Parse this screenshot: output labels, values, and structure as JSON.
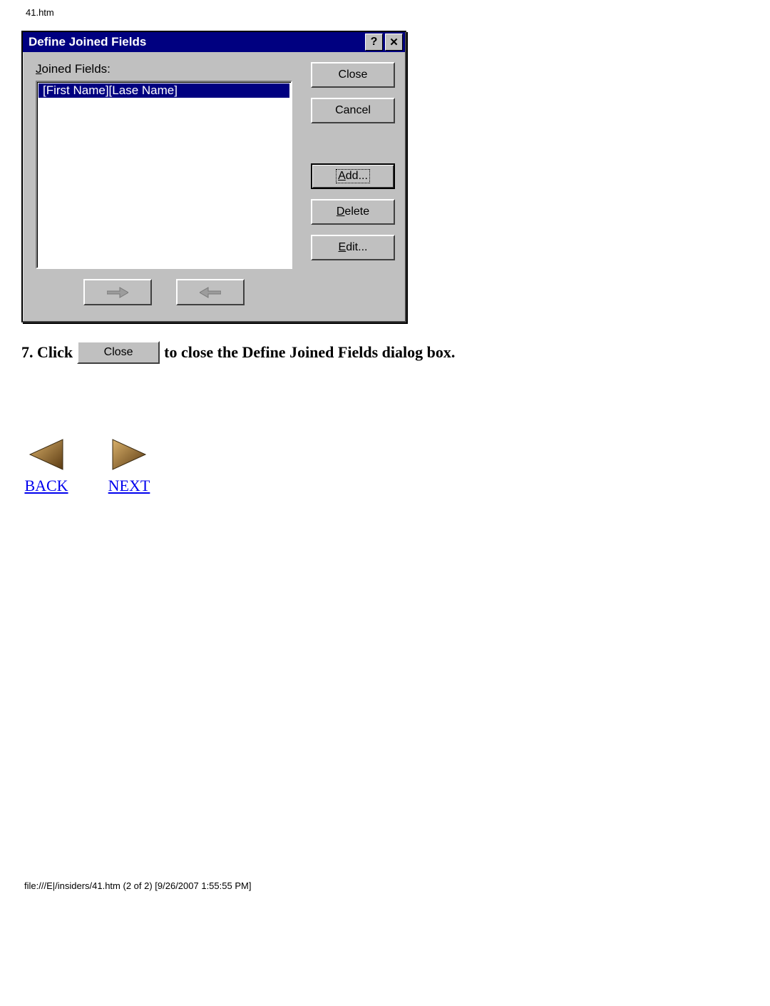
{
  "header": {
    "filename": "41.htm"
  },
  "dialog": {
    "title": "Define Joined Fields",
    "help_glyph": "?",
    "close_glyph": "✕",
    "label": "Joined Fields:",
    "list_items": [
      "[First Name][Lase Name]"
    ],
    "buttons": {
      "close": "Close",
      "cancel": "Cancel",
      "add": "Add...",
      "delete": "Delete",
      "edit": "Edit..."
    }
  },
  "instruction": {
    "prefix": "7. Click ",
    "button_label": "Close",
    "suffix": " to close the Define Joined Fields dialog box."
  },
  "nav": {
    "back": "BACK",
    "next": "NEXT"
  },
  "footer": "file:///E|/insiders/41.htm (2 of 2) [9/26/2007 1:55:55 PM]"
}
